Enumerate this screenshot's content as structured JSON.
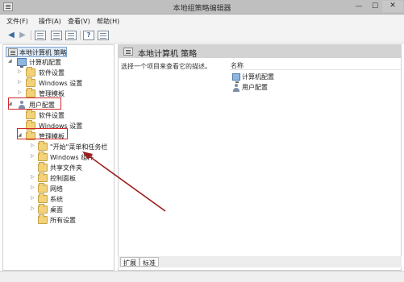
{
  "window": {
    "title": "本地组策略编辑器"
  },
  "menu": {
    "file": "文件(F)",
    "action": "操作(A)",
    "view": "查看(V)",
    "help": "帮助(H)"
  },
  "tree": {
    "root": "本地计算机 策略",
    "computer_config": "计算机配置",
    "software_settings": "软件设置",
    "windows_settings": "Windows 设置",
    "admin_templates": "管理模板",
    "user_config": "用户配置",
    "user_software_settings": "软件设置",
    "user_windows_settings": "Windows 设置",
    "user_admin_templates": "管理模板",
    "children": [
      "\"开始\"菜单和任务栏",
      "Windows 组件",
      "共享文件夹",
      "控制面板",
      "网络",
      "系统",
      "桌面",
      "所有设置"
    ]
  },
  "right": {
    "title": "本地计算机 策略",
    "description": "选择一个项目来查看它的描述。",
    "column_name": "名称",
    "items": [
      "计算机配置",
      "用户配置"
    ]
  },
  "tabs": {
    "extended": "扩展",
    "standard": "标准"
  },
  "annotation": {
    "color": "#d3282c"
  }
}
